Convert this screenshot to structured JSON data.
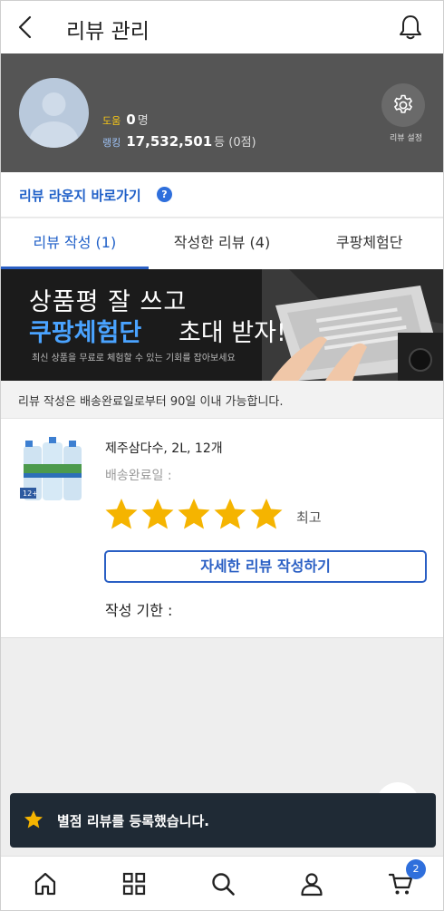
{
  "header": {
    "title": "리뷰 관리"
  },
  "profile": {
    "help_label": "도움",
    "help_value": "0",
    "help_unit": "명",
    "rank_label": "랭킹",
    "rank_value": "17,532,501",
    "rank_unit": "등 (0점)",
    "settings_label": "리뷰 설정"
  },
  "lounge": {
    "link_text": "리뷰 라운지 바로가기",
    "help_symbol": "?"
  },
  "tabs": [
    {
      "label": "리뷰 작성 (1)",
      "active": true
    },
    {
      "label": "작성한 리뷰 (4)",
      "active": false
    },
    {
      "label": "쿠팡체험단",
      "active": false
    }
  ],
  "banner": {
    "line1": "상품평 잘 쓰고",
    "line2_highlight": "쿠팡체험단",
    "line2_rest": "초대 받자!",
    "subtext": "최신 상품을 무료로 체험할 수 있는 기회를 잡아보세요"
  },
  "notice": {
    "text": "리뷰 작성은 배송완료일로부터 90일 이내 가능합니다."
  },
  "product": {
    "name": "제주삼다수, 2L, 12개",
    "delivery_label": "배송완료일 :",
    "rating": 5,
    "rating_max": 5,
    "rating_label": "최고",
    "write_button": "자세한 리뷰 작성하기",
    "deadline_label": "작성 기한 :",
    "pack_label": "12+"
  },
  "toast": {
    "text": "별점 리뷰를 등록했습니다."
  },
  "bottom_nav": {
    "items": [
      "home-icon",
      "category-grid-icon",
      "search-icon",
      "user-icon",
      "cart-icon"
    ],
    "cart_badge": "2"
  },
  "colors": {
    "accent": "#2a5fc4",
    "star": "#f5b400",
    "toast_bg": "#1f2a35",
    "profile_bg": "#555555"
  }
}
